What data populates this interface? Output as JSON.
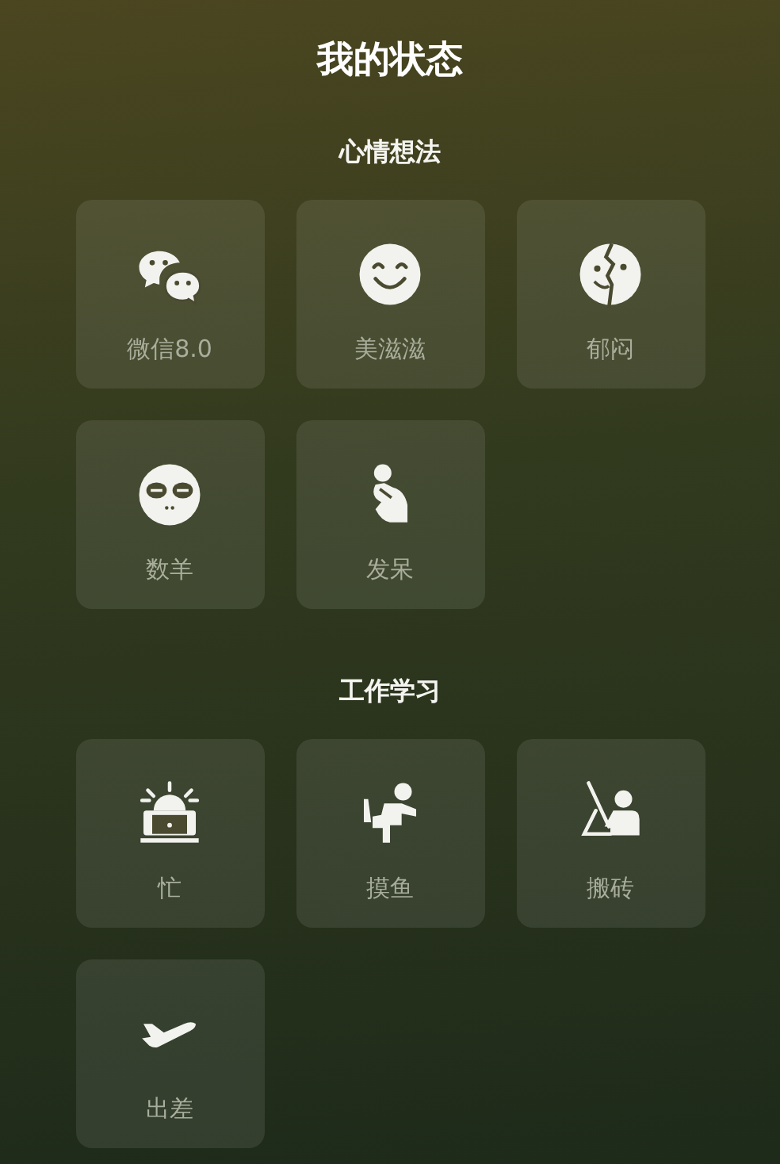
{
  "title": "我的状态",
  "sections": [
    {
      "heading": "心情想法",
      "items": [
        {
          "label": "微信8.0"
        },
        {
          "label": "美滋滋"
        },
        {
          "label": "郁闷"
        },
        {
          "label": "数羊"
        },
        {
          "label": "发呆"
        }
      ]
    },
    {
      "heading": "工作学习",
      "items": [
        {
          "label": "忙"
        },
        {
          "label": "摸鱼"
        },
        {
          "label": "搬砖"
        },
        {
          "label": "出差"
        }
      ]
    }
  ]
}
